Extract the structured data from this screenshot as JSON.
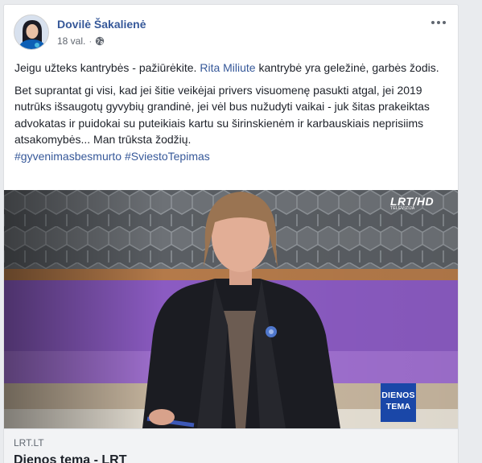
{
  "post": {
    "author": "Dovilė Šakalienė",
    "time": "18 val.",
    "paragraph1_part1": "Jeigu užteks kantrybės - pažiūrėkite. ",
    "paragraph1_mention": "Rita Miliute",
    "paragraph1_part2": " kantrybė yra geležinė, garbės žodis.",
    "paragraph2": "Bet suprantat gi visi, kad jei šitie veikėjai privers visuomenę pasukti atgal, jei 2019 nutrūks išsaugotų gyvybių grandinė, jei vėl bus nužudyti vaikai - juk šitas prakeiktas advokatas ir puidokai su puteikiais kartu su širinskienėm ir karbauskiais neprisiims atsakomybės... Man trūksta žodžių.",
    "hashtag1": "#gyvenimasbesmurto",
    "hashtag2": "#SviestoTepimas"
  },
  "media": {
    "channel_logo": "LRT/HD",
    "channel_sub": "TELEVIZIJA",
    "badge_line1": "DIENOS",
    "badge_line2": "TEMA"
  },
  "link_preview": {
    "domain": "LRT.LT",
    "title": "Dienos tema - LRT"
  },
  "icons": {
    "privacy": "globe-icon",
    "menu": "more-options-icon"
  },
  "colors": {
    "link": "#365899",
    "text": "#1d2129",
    "muted": "#616770",
    "badge": "#1a47a8"
  }
}
